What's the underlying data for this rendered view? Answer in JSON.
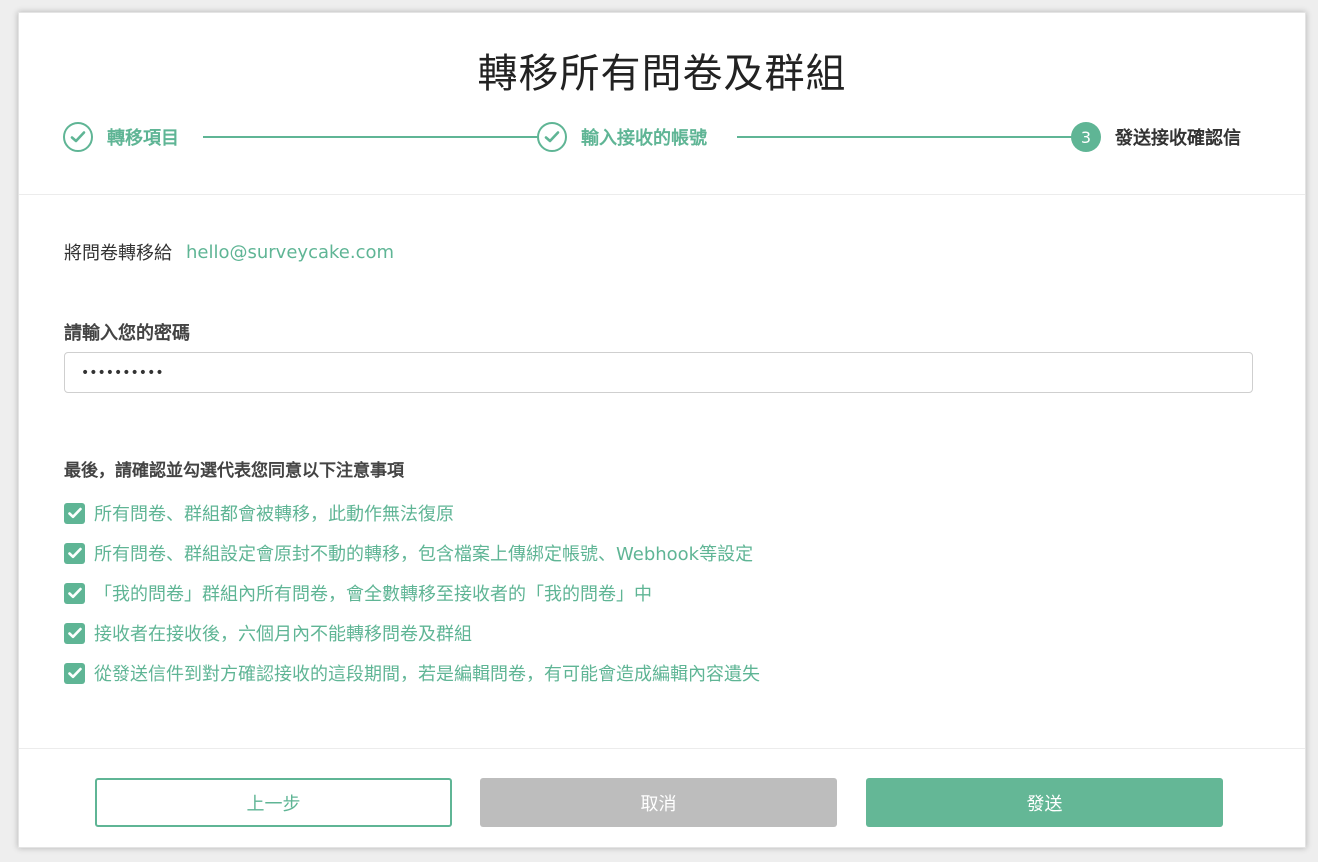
{
  "title": "轉移所有問卷及群組",
  "steps": [
    {
      "label": "轉移項目",
      "state": "done",
      "icon": "check-icon"
    },
    {
      "label": "輸入接收的帳號",
      "state": "done",
      "icon": "check-icon"
    },
    {
      "label": "發送接收確認信",
      "state": "active",
      "number": "3"
    }
  ],
  "transfer": {
    "label": "將問卷轉移給",
    "email": "hello@surveycake.com"
  },
  "password": {
    "label": "請輸入您的密碼",
    "value": "••••••••••"
  },
  "confirm": {
    "heading": "最後，請確認並勾選代表您同意以下注意事項",
    "items": [
      {
        "text": "所有問卷、群組都會被轉移，此動作無法復原",
        "checked": true
      },
      {
        "text": "所有問卷、群組設定會原封不動的轉移，包含檔案上傳綁定帳號、Webhook等設定",
        "checked": true
      },
      {
        "text": "「我的問卷」群組內所有問卷，會全數轉移至接收者的「我的問卷」中",
        "checked": true
      },
      {
        "text": "接收者在接收後，六個月內不能轉移問卷及群組",
        "checked": true
      },
      {
        "text": "從發送信件到對方確認接收的這段期間，若是編輯問卷，有可能會造成編輯內容遺失",
        "checked": true
      }
    ]
  },
  "buttons": {
    "back": "上一步",
    "cancel": "取消",
    "send": "發送"
  },
  "colors": {
    "accent": "#5fb595",
    "disabled": "#bdbdbd"
  }
}
